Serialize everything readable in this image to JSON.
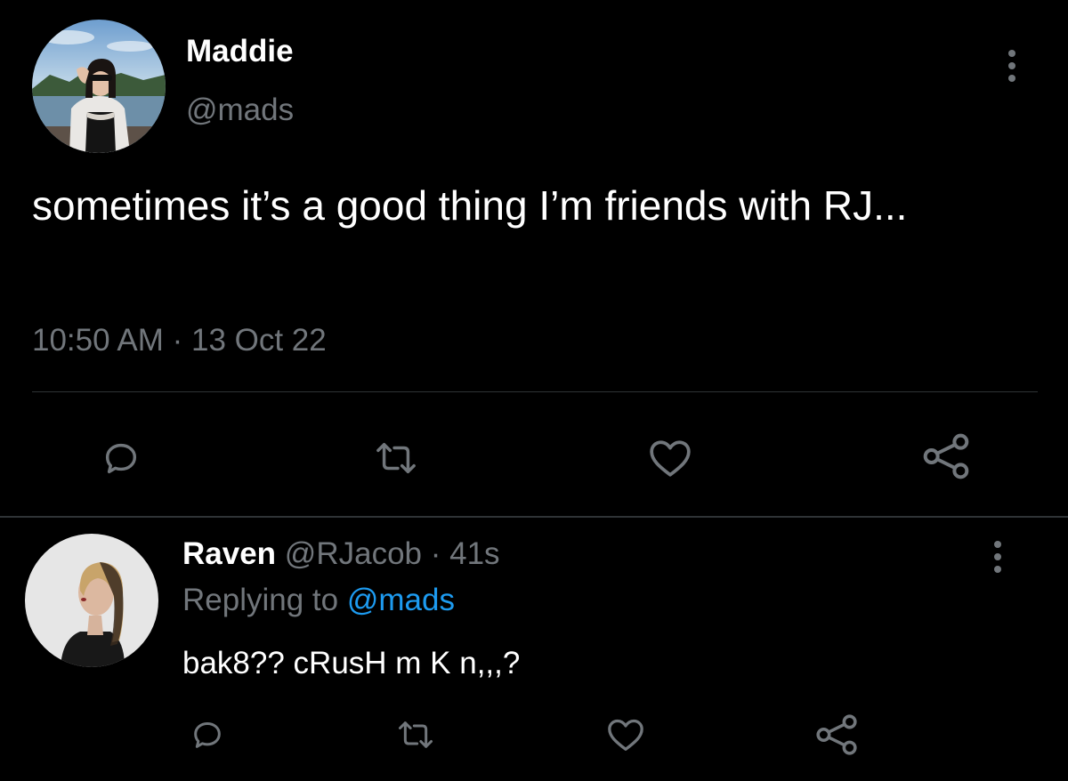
{
  "tweet": {
    "author_name": "Maddie",
    "author_handle": "@mads",
    "text": "sometimes it’s a good thing I’m friends with RJ...",
    "timestamp": "10:50 AM · 13 Oct 22",
    "avatar_icon": "profile-photo",
    "more_icon": "more-vertical-icon",
    "actions": {
      "reply_icon": "reply-icon",
      "retweet_icon": "retweet-icon",
      "like_icon": "heart-icon",
      "share_icon": "share-icon"
    }
  },
  "reply": {
    "author_name": "Raven",
    "author_meta": "@RJacob · 41s",
    "replying_prefix": "Replying to",
    "replying_to": "@mads",
    "text": "bak8?? cRusH m K n,,,?",
    "avatar_icon": "profile-photo",
    "more_icon": "more-vertical-icon"
  },
  "colors": {
    "background": "#000000",
    "primary_text": "#ffffff",
    "secondary_text": "#71767b",
    "accent": "#1d9bf0",
    "divider": "#2f3336"
  }
}
